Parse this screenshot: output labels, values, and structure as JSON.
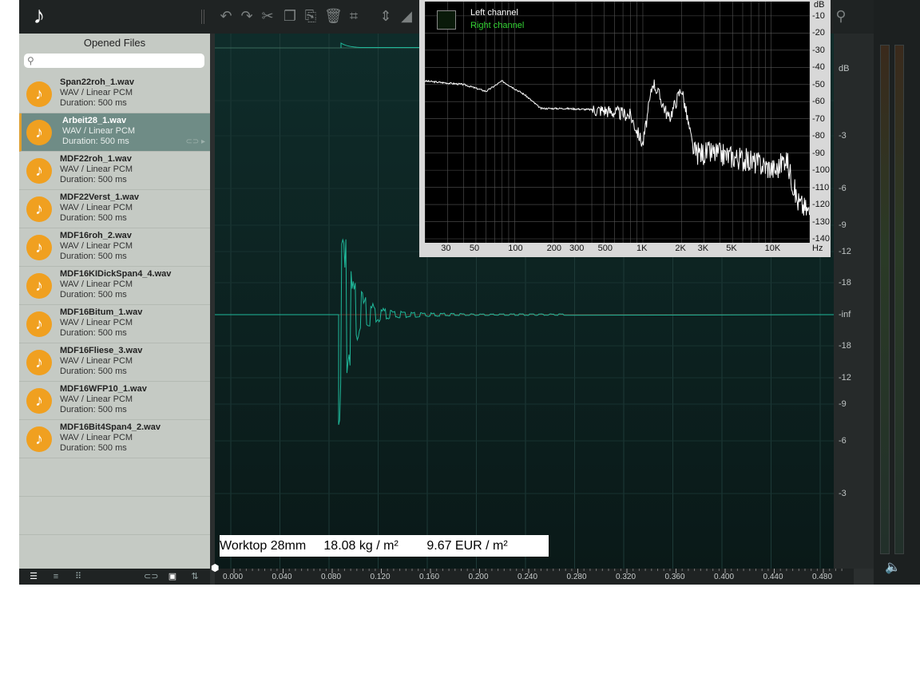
{
  "sidebar": {
    "title": "Opened Files",
    "files": [
      {
        "name": "Span22roh_1.wav",
        "type": "WAV / Linear PCM",
        "duration": "Duration: 500 ms"
      },
      {
        "name": "Arbeit28_1.wav",
        "type": "WAV / Linear PCM",
        "duration": "Duration: 500 ms"
      },
      {
        "name": "MDF22roh_1.wav",
        "type": "WAV / Linear PCM",
        "duration": "Duration: 500 ms"
      },
      {
        "name": "MDF22Verst_1.wav",
        "type": "WAV / Linear PCM",
        "duration": "Duration: 500 ms"
      },
      {
        "name": "MDF16roh_2.wav",
        "type": "WAV / Linear PCM",
        "duration": "Duration: 500 ms"
      },
      {
        "name": "MDF16KIDickSpan4_4.wav",
        "type": "WAV / Linear PCM",
        "duration": "Duration: 500 ms"
      },
      {
        "name": "MDF16Bitum_1.wav",
        "type": "WAV / Linear PCM",
        "duration": "Duration: 500 ms"
      },
      {
        "name": "MDF16Fliese_3.wav",
        "type": "WAV / Linear PCM",
        "duration": "Duration: 500 ms"
      },
      {
        "name": "MDF16WFP10_1.wav",
        "type": "WAV / Linear PCM",
        "duration": "Duration: 500 ms"
      },
      {
        "name": "MDF16Bit4Span4_2.wav",
        "type": "WAV / Linear PCM",
        "duration": "Duration: 500 ms"
      }
    ],
    "selected_index": 1
  },
  "caption": "Worktop 28mm     18.08 kg / m²        9.67 EUR / m²",
  "spectrum": {
    "legend_left": "Left channel",
    "legend_right": "Right channel",
    "db_unit": "dB",
    "db_ticks": [
      "-10",
      "-20",
      "-30",
      "-40",
      "-50",
      "-60",
      "-70",
      "-80",
      "-90",
      "-100",
      "-110",
      "-120",
      "-130",
      "-140"
    ],
    "hz_unit": "Hz",
    "hz_ticks": [
      "30",
      "50",
      "100",
      "200",
      "300",
      "500",
      "1K",
      "2K",
      "3K",
      "5K",
      "10K"
    ]
  },
  "waveform": {
    "db_unit": "dB",
    "db_scale": [
      "-3",
      "-6",
      "-9",
      "-12",
      "-18",
      "-inf",
      "-18",
      "-12",
      "-9",
      "-6",
      "-3"
    ],
    "time_ticks": [
      "0.000",
      "0.040",
      "0.080",
      "0.120",
      "0.160",
      "0.200",
      "0.240",
      "0.280",
      "0.320",
      "0.360",
      "0.400",
      "0.440",
      "0.480"
    ]
  },
  "colors": {
    "accent": "#f0a020",
    "wave": "#1fb89a",
    "selected_row": "#6f8c86",
    "spectrum_right": "#35d535"
  }
}
